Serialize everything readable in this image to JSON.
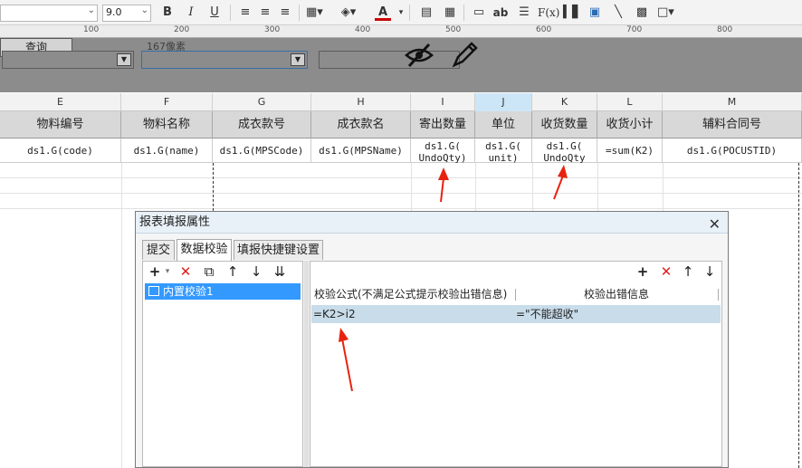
{
  "toolbar": {
    "font_size": "9.0",
    "buttons": [
      "B",
      "I",
      "U",
      "F(x)",
      "ab"
    ]
  },
  "ruler": {
    "marks": [
      "100",
      "200",
      "300",
      "400",
      "500",
      "600",
      "700",
      "800"
    ]
  },
  "param_panel": {
    "label_left": "像素",
    "label_top": "167像素",
    "query_label": "查询"
  },
  "grid": {
    "columns": [
      "E",
      "F",
      "G",
      "H",
      "I",
      "J",
      "K",
      "L",
      "M"
    ],
    "headers": [
      "物料编号",
      "物料名称",
      "成衣款号",
      "成衣款名",
      "寄出数量",
      "单位",
      "收货数量",
      "收货小计",
      "辅料合同号"
    ],
    "cells": [
      "ds1.G(code)",
      "ds1.G(name)",
      "ds1.G(MPSCode)",
      "ds1.G(MPSName)",
      "ds1.G(\nUndoQty)",
      "ds1.G(\nunit)",
      "ds1.G(\nUndoQty",
      "=sum(K2)",
      "ds1.G(POCUSTID)"
    ]
  },
  "dialog": {
    "title": "报表填报属性",
    "tabs": [
      "提交",
      "数据校验",
      "填报快捷键设置"
    ],
    "tree_item": "内置校验1",
    "validation_headers": [
      "校验公式(不满足公式提示校验出错信息)",
      "校验出错信息"
    ],
    "validation_rows": [
      {
        "formula": "=K2>i2",
        "message": "=\"不能超收\""
      }
    ]
  }
}
